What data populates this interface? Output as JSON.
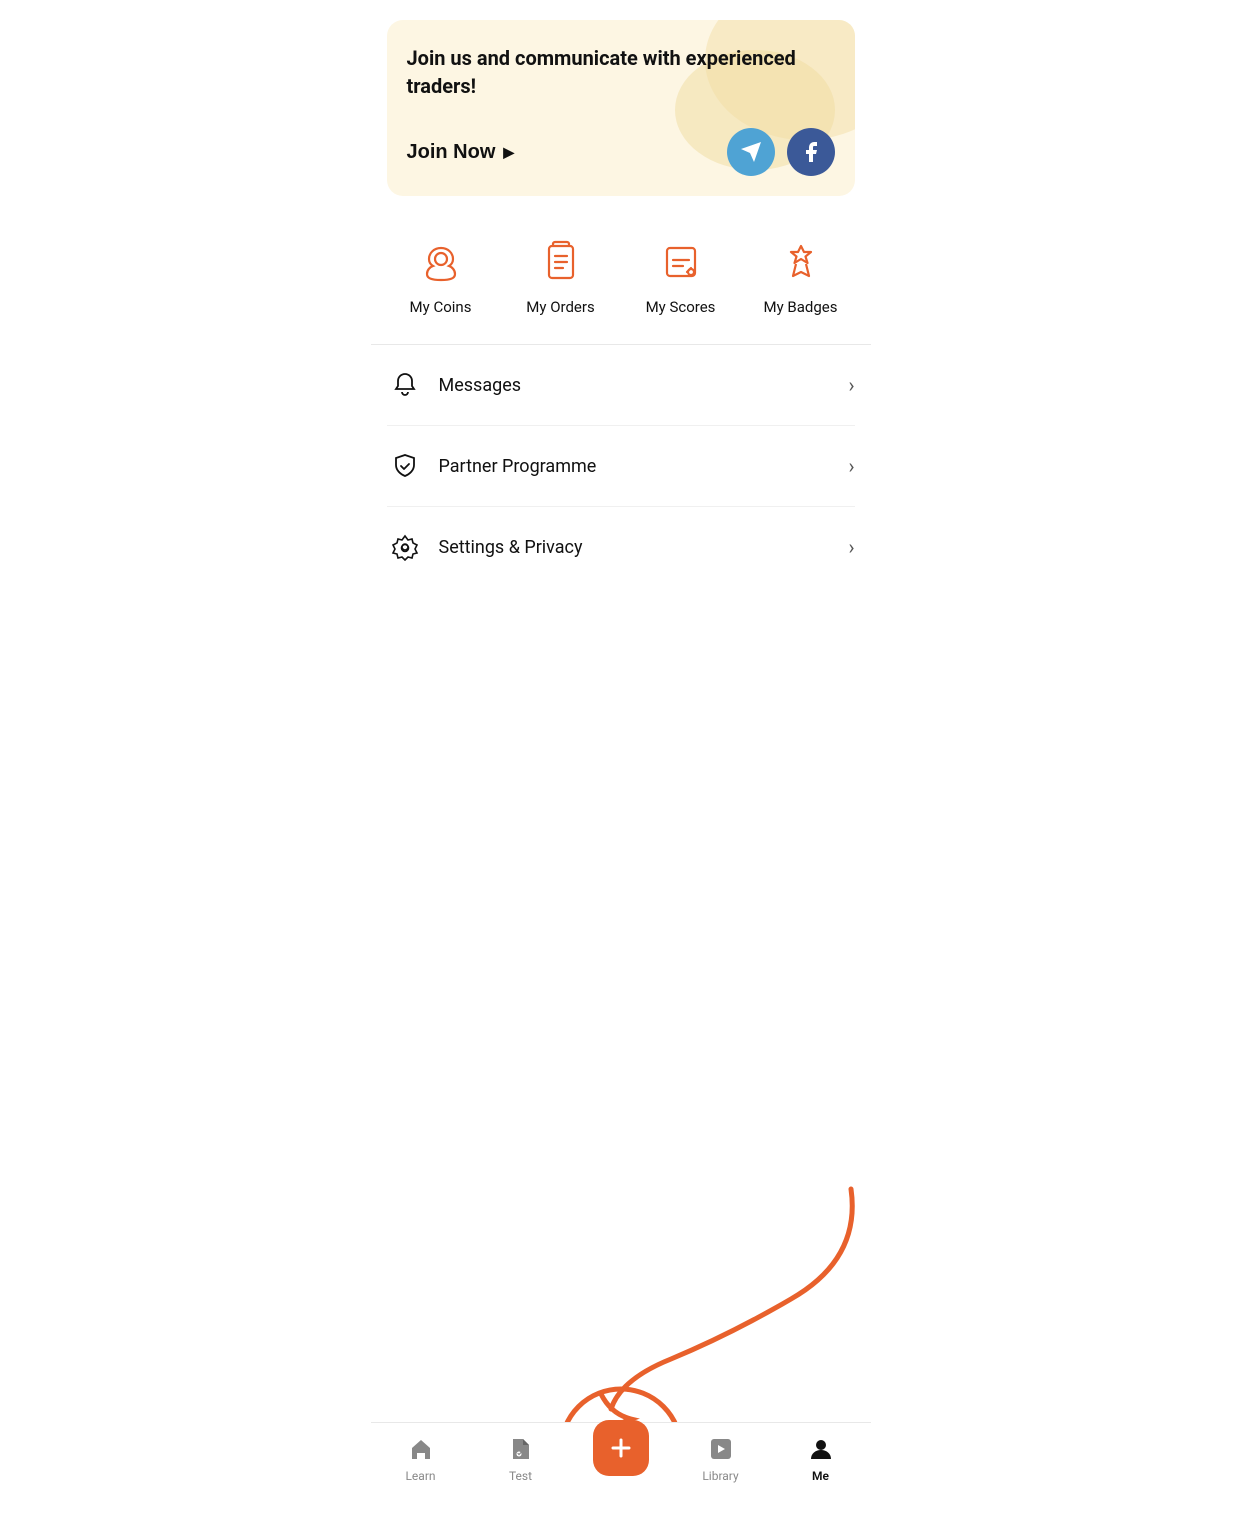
{
  "banner": {
    "title": "Join us and communicate with experienced traders!",
    "join_label": "Join Now",
    "telegram_alt": "Telegram",
    "facebook_alt": "Facebook"
  },
  "quick_actions": [
    {
      "id": "coins",
      "label": "My Coins",
      "icon": "coins"
    },
    {
      "id": "orders",
      "label": "My Orders",
      "icon": "orders"
    },
    {
      "id": "scores",
      "label": "My Scores",
      "icon": "scores"
    },
    {
      "id": "badges",
      "label": "My Badges",
      "icon": "badges"
    }
  ],
  "menu_items": [
    {
      "id": "messages",
      "label": "Messages",
      "icon": "bell"
    },
    {
      "id": "partner",
      "label": "Partner Programme",
      "icon": "shield"
    },
    {
      "id": "settings",
      "label": "Settings & Privacy",
      "icon": "settings"
    }
  ],
  "bottom_nav": [
    {
      "id": "learn",
      "label": "Learn",
      "icon": "home",
      "active": false
    },
    {
      "id": "test",
      "label": "Test",
      "icon": "test",
      "active": false
    },
    {
      "id": "add",
      "label": "",
      "icon": "plus",
      "active": false,
      "center": true
    },
    {
      "id": "library",
      "label": "Library",
      "icon": "library",
      "active": false
    },
    {
      "id": "me",
      "label": "Me",
      "icon": "person",
      "active": true
    }
  ],
  "accent_color": "#e8612c",
  "dark_accent": "#3b5998",
  "telegram_color": "#4fa3d4"
}
